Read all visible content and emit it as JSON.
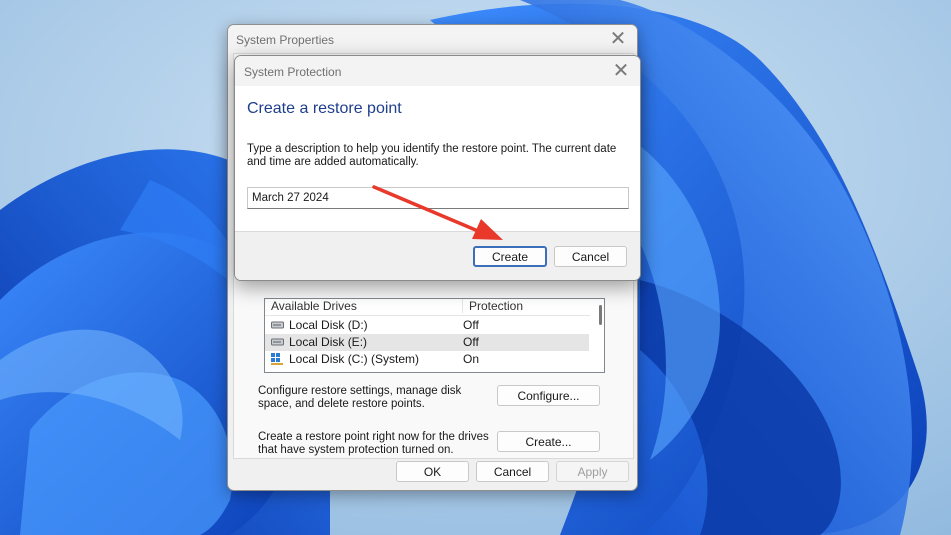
{
  "system_properties": {
    "title": "System Properties",
    "drives_table": {
      "headers": [
        "Available Drives",
        "Protection"
      ],
      "rows": [
        {
          "name": "Local Disk (D:)",
          "protection": "Off",
          "icon": "drive-icon"
        },
        {
          "name": "Local Disk (E:)",
          "protection": "Off",
          "icon": "drive-icon"
        },
        {
          "name": "Local Disk (C:) (System)",
          "protection": "On",
          "icon": "windows-drive-icon"
        }
      ]
    },
    "configure_text": "Configure restore settings, manage disk space, and delete restore points.",
    "configure_label": "Configure...",
    "create_text": "Create a restore point right now for the drives that have system protection turned on.",
    "create_label": "Create...",
    "ok_label": "OK",
    "cancel_label": "Cancel",
    "apply_label": "Apply"
  },
  "system_protection": {
    "title": "System Protection",
    "heading": "Create a restore point",
    "description": "Type a description to help you identify the restore point. The current date and time are added automatically.",
    "input_value": "March 27 2024",
    "create_label": "Create",
    "cancel_label": "Cancel"
  },
  "colors": {
    "accent": "#1f3f8c",
    "annotation_arrow": "#e8392b",
    "wallpaper_blue": "#1560e0"
  }
}
